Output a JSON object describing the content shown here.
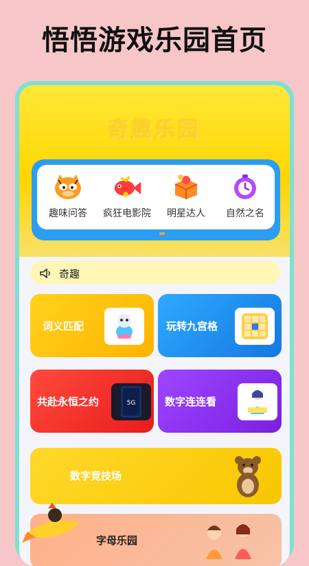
{
  "headline": "悟悟游戏乐园首页",
  "hero": {
    "title": "奇趣乐园"
  },
  "categories": [
    {
      "label": "趣味问答",
      "icon": "cat-face-icon"
    },
    {
      "label": "疯狂电影院",
      "icon": "fish-icon"
    },
    {
      "label": "明星达人",
      "icon": "gift-box-icon"
    },
    {
      "label": "自然之名",
      "icon": "stopwatch-icon"
    }
  ],
  "notice": {
    "text": "奇趣",
    "icon": "speaker-icon"
  },
  "cards": [
    {
      "label": "词义匹配",
      "icon": "robot-toy-icon"
    },
    {
      "label": "玩转九宫格",
      "icon": "grid-puzzle-icon"
    },
    {
      "label": "共赴永恒之约",
      "icon": "phone-5g-icon",
      "badge": "5G"
    },
    {
      "label": "数字连连看",
      "icon": "girl-reading-icon"
    },
    {
      "label": "数字竞技场",
      "icon": "bear-icon"
    },
    {
      "label": "字母乐园",
      "icon": "kids-icon"
    }
  ],
  "colors": {
    "background": "#f6c6c8",
    "accent_blue": "#2b9df3",
    "accent_yellow": "#ffd500"
  }
}
